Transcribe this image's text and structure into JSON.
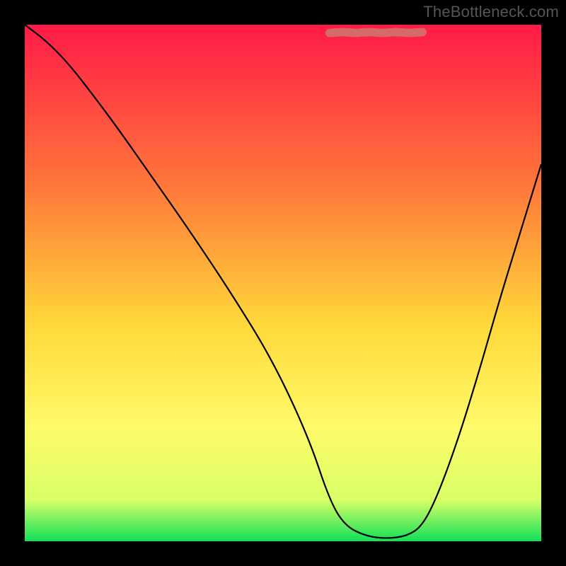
{
  "watermark": "TheBottleneck.com",
  "chart_data": {
    "type": "line",
    "title": "",
    "xlabel": "",
    "ylabel": "",
    "xlim": [
      0,
      100
    ],
    "ylim": [
      0,
      100
    ],
    "gradient_stops": [
      {
        "offset": 0,
        "color": "#ff1a47"
      },
      {
        "offset": 32,
        "color": "#ff7a3a"
      },
      {
        "offset": 58,
        "color": "#ffd83a"
      },
      {
        "offset": 78,
        "color": "#fffb6a"
      },
      {
        "offset": 92,
        "color": "#d9ff66"
      },
      {
        "offset": 100,
        "color": "#10e05a"
      }
    ],
    "optimum_band": {
      "x_start": 59,
      "x_end": 77,
      "y": 98.5,
      "color": "#d46a6a",
      "thickness": 1.6
    },
    "series": [
      {
        "name": "bottleneck-curve",
        "color": "#000000",
        "x": [
          0,
          4,
          8,
          12,
          18,
          25,
          32,
          40,
          48,
          55,
          59,
          62,
          66,
          70,
          74,
          77,
          80,
          84,
          88,
          92,
          96,
          100
        ],
        "y": [
          100,
          97,
          93,
          88,
          80,
          70,
          60,
          48,
          35,
          20,
          8,
          3,
          1,
          0.5,
          1,
          3,
          9,
          20,
          33,
          47,
          60,
          73
        ]
      }
    ]
  }
}
